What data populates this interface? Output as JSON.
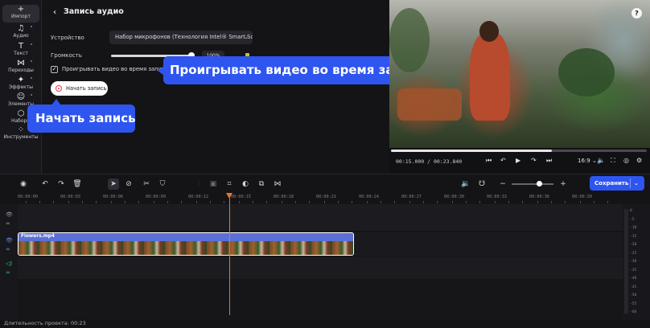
{
  "nav": {
    "items": [
      {
        "label": "Импорт",
        "icon": "plus-icon",
        "glyph": "+"
      },
      {
        "label": "Аудио",
        "icon": "music-note-icon",
        "glyph": "♫"
      },
      {
        "label": "Текст",
        "icon": "text-icon",
        "glyph": "T"
      },
      {
        "label": "Переходы",
        "icon": "transitions-icon",
        "glyph": "⋈"
      },
      {
        "label": "Эффекты",
        "icon": "effects-icon",
        "glyph": "✦"
      },
      {
        "label": "Элементы",
        "icon": "elements-icon",
        "glyph": "☺"
      },
      {
        "label": "Наборы",
        "icon": "sets-icon",
        "glyph": "⬡"
      },
      {
        "label": "Инструменты",
        "icon": "tools-icon",
        "glyph": "⁘"
      }
    ]
  },
  "panel": {
    "title": "Запись аудио",
    "device_label": "Устройство",
    "device_value": "Набор микрофонов (Технология Intel® Smart So...",
    "volume_label": "Громкость",
    "volume_value": "100%",
    "volume_level": 0.95,
    "play_video_checkbox": "Проигрывать видео во время записи",
    "play_video_checked": true,
    "record_button": "Начать запись"
  },
  "tooltips": {
    "play_video": "Проигрывать видео во время записи",
    "start_record": "Начать запись"
  },
  "preview": {
    "current_time": "00:15.000",
    "total_time": "00:23.840",
    "progress": 0.63,
    "aspect_ratio": "16:9"
  },
  "toolbar": {
    "save_label": "Сохранить",
    "zoom_level": 0.65
  },
  "ruler": {
    "ticks": [
      "00:00:00",
      "00:00:03",
      "00:00:06",
      "00:00:09",
      "00:00:12",
      "00:00:15",
      "00:00:18",
      "00:00:21",
      "00:00:24",
      "00:00:27",
      "00:00:30",
      "00:00:33",
      "00:00:36",
      "00:00:39"
    ]
  },
  "timeline": {
    "clip_name": "Flowers.mp4"
  },
  "meter": {
    "labels": [
      "0",
      "-5",
      "-10",
      "-15",
      "-20",
      "-25",
      "-30",
      "-35",
      "-40",
      "-45",
      "-50",
      "-55",
      "-60"
    ]
  },
  "footer": {
    "duration_label": "Длительность проекта: 00:23"
  }
}
